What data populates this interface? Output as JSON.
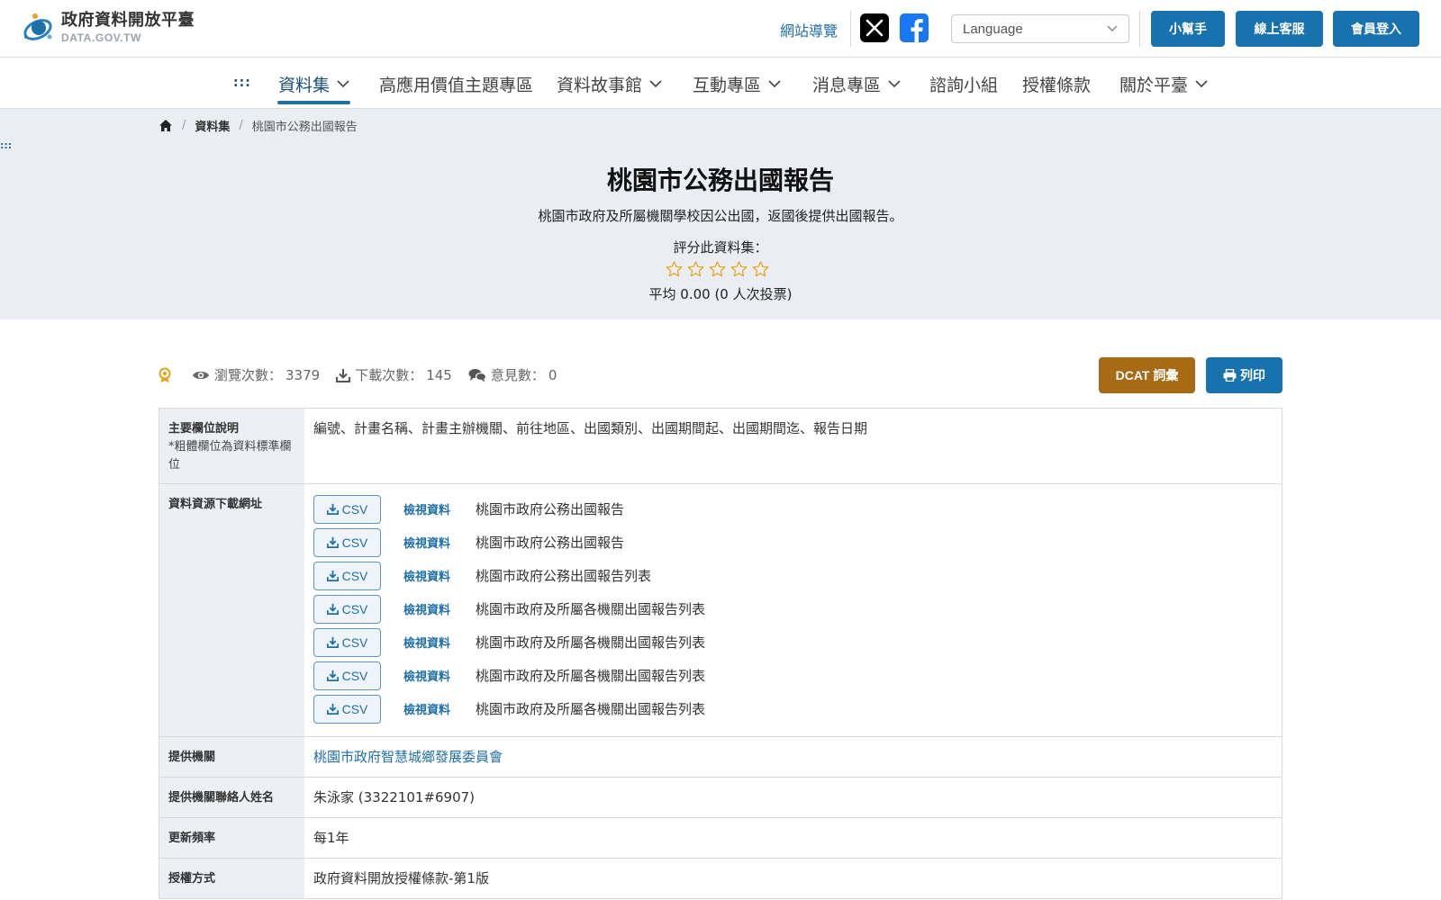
{
  "header": {
    "logo_zh": "政府資料開放平臺",
    "logo_en": "DATA.GOV.TW",
    "sitemap": "網站導覽",
    "language_placeholder": "Language",
    "buttons": {
      "helper": "小幫手",
      "support": "線上客服",
      "login": "會員登入"
    }
  },
  "nav": {
    "dots": ":::",
    "items": [
      "資料集",
      "高應用價值主題專區",
      "資料故事館",
      "互動專區",
      "消息專區",
      "諮詢小組",
      "授權條款",
      "關於平臺"
    ]
  },
  "breadcrumb": {
    "dataset": "資料集",
    "current": "桃園市公務出國報告"
  },
  "side_dots": ":::",
  "dataset": {
    "title": "桃園市公務出國報告",
    "description": "桃園市政府及所屬機關學校因公出國，返國後提供出國報告。",
    "rating_label": "評分此資料集：",
    "rating_value": 0,
    "rating_max": 5,
    "average_text": "平均 0.00 (0 人次投票)"
  },
  "stats": {
    "views_label": "瀏覽次數：",
    "views": "3379",
    "downloads_label": "下載次數：",
    "downloads": "145",
    "comments_label": "意見數：",
    "comments": "0",
    "dcat_label": "DCAT 詞彙",
    "print_label": "列印"
  },
  "table": {
    "fields_label": "主要欄位說明",
    "fields_note": "*粗體欄位為資料標準欄位",
    "fields_value": "編號、計畫名稱、計畫主辦機關、前往地區、出國類別、出國期間起、出國期間迄、報告日期",
    "resources_label": "資料資源下載網址",
    "format_label": "CSV",
    "view_label": "檢視資料",
    "resources": [
      "桃園市政府公務出國報告",
      "桃園市政府公務出國報告",
      "桃園市政府公務出國報告列表",
      "桃園市政府及所屬各機關出國報告列表",
      "桃園市政府及所屬各機關出國報告列表",
      "桃園市政府及所屬各機關出國報告列表",
      "桃園市政府及所屬各機關出國報告列表"
    ],
    "provider_label": "提供機關",
    "provider": "桃園市政府智慧城鄉發展委員會",
    "contact_label": "提供機關聯絡人姓名",
    "contact": "朱泳家 (3322101#6907)",
    "frequency_label": "更新頻率",
    "frequency": "每1年",
    "license_label": "授權方式",
    "license": "政府資料開放授權條款-第1版"
  },
  "colors": {
    "primary": "#1872ad",
    "dcat": "#a86a14",
    "hero_bg": "#eaeef2",
    "star": "#e8a317"
  }
}
